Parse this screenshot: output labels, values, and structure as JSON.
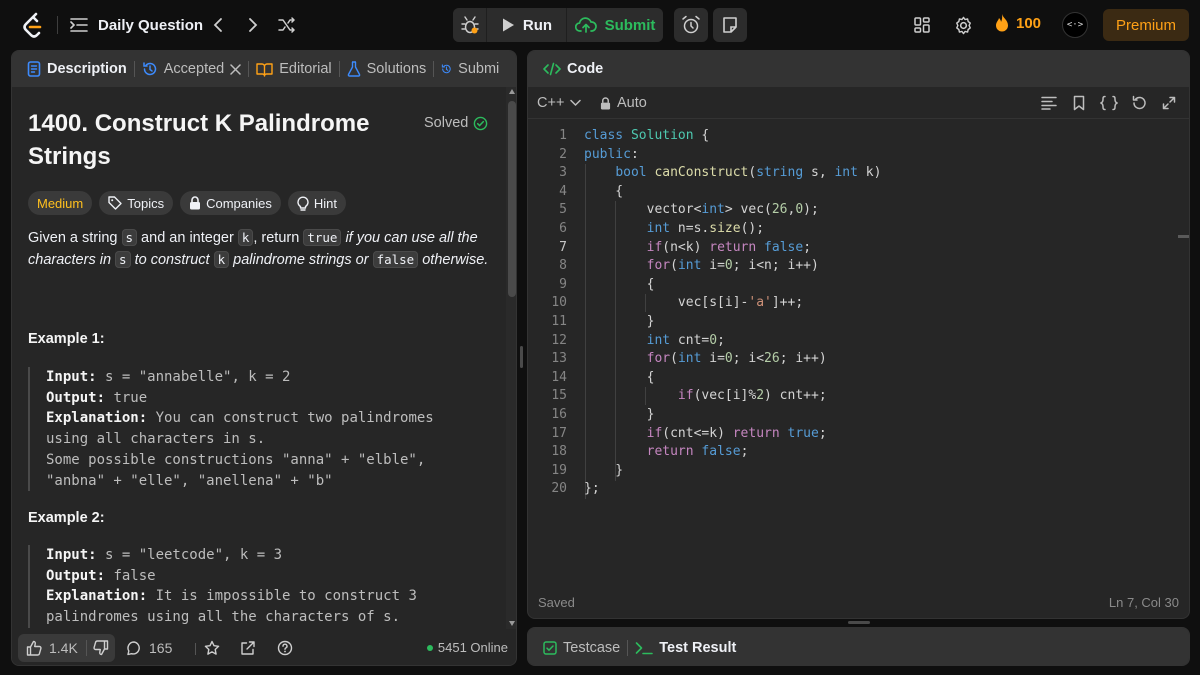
{
  "topbar": {
    "daily_label": "Daily Question",
    "run_label": "Run",
    "submit_label": "Submit",
    "streak_count": "100",
    "avatar_text": "<·>",
    "premium_label": "Premium"
  },
  "left_tabs": [
    {
      "label": "Description"
    },
    {
      "label": "Accepted"
    },
    {
      "label": "Editorial"
    },
    {
      "label": "Solutions"
    },
    {
      "label": "Submi"
    }
  ],
  "problem": {
    "title": "1400. Construct K Palindrome Strings",
    "status": "Solved",
    "chips": [
      "Medium",
      "Topics",
      "Companies",
      "Hint"
    ],
    "desc": {
      "p1": "Given a string ",
      "c1": "s",
      "p2": " and an integer ",
      "c2": "k",
      "p3": ", return ",
      "c3": "true",
      "p4": " if you can use all the characters in ",
      "c4": "s",
      "p5": " to construct ",
      "c5": "k",
      "p6": " palindrome strings or ",
      "c6": "false",
      "p7": " otherwise."
    },
    "examples": [
      {
        "title": "Example 1:",
        "input_label": "Input:",
        "input": " s = \"annabelle\", k = 2",
        "output_label": "Output:",
        "output": " true",
        "expl_label": "Explanation:",
        "expl_lines": [
          " You can construct two palindromes",
          "using all characters in s.",
          "Some possible constructions \"anna\" + \"elble\",",
          "\"anbna\" + \"elle\", \"anellena\" + \"b\""
        ]
      },
      {
        "title": "Example 2:",
        "input_label": "Input:",
        "input": " s = \"leetcode\", k = 3",
        "output_label": "Output:",
        "output": " false",
        "expl_label": "Explanation:",
        "expl_lines": [
          " It is impossible to construct 3",
          "palindromes using all the characters of s."
        ]
      }
    ]
  },
  "footer": {
    "likes": "1.4K",
    "comments": "165",
    "online": "5451 Online"
  },
  "code_panel": {
    "tab_label": "Code",
    "language": "C++",
    "mode": "Auto",
    "saved": "Saved",
    "cursor": "Ln 7, Col 30",
    "line_numbers": [
      "1",
      "2",
      "3",
      "4",
      "5",
      "6",
      "7",
      "8",
      "9",
      "10",
      "11",
      "12",
      "13",
      "14",
      "15",
      "16",
      "17",
      "18",
      "19",
      "20"
    ]
  },
  "bottom_tabs": {
    "testcase": "Testcase",
    "test_result": "Test Result"
  },
  "colors": {
    "accent": "#ffa116",
    "green": "#2cbb5d",
    "medium": "#ffc01e",
    "panel": "#262626",
    "bg": "#0f0f0f"
  }
}
